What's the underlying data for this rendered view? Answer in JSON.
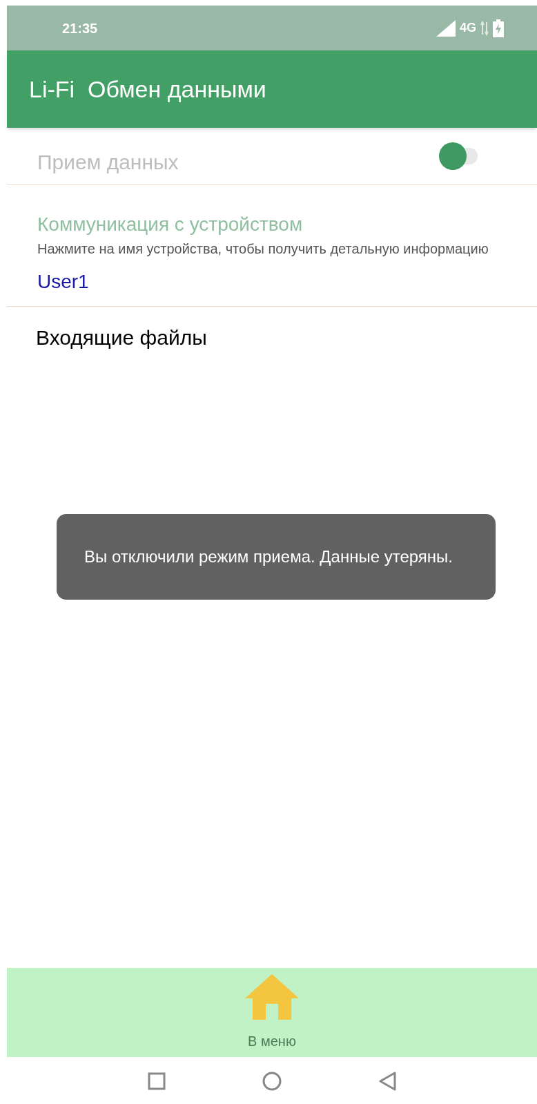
{
  "status_bar": {
    "time": "21:35",
    "network": "4G"
  },
  "app_bar": {
    "title": "Li-Fi  Обмен данными"
  },
  "receive_switch": {
    "label": "Прием данных",
    "on": false
  },
  "device_section": {
    "title": "Коммуникация с устройством",
    "hint": "Нажмите на имя устройства, чтобы получить детальную информацию",
    "devices": [
      "User1"
    ]
  },
  "incoming": {
    "title": "Входящие файлы"
  },
  "toast": {
    "text": "Вы отключили режим приема. Данные утеряны."
  },
  "bottom_nav": {
    "label": "В меню"
  }
}
